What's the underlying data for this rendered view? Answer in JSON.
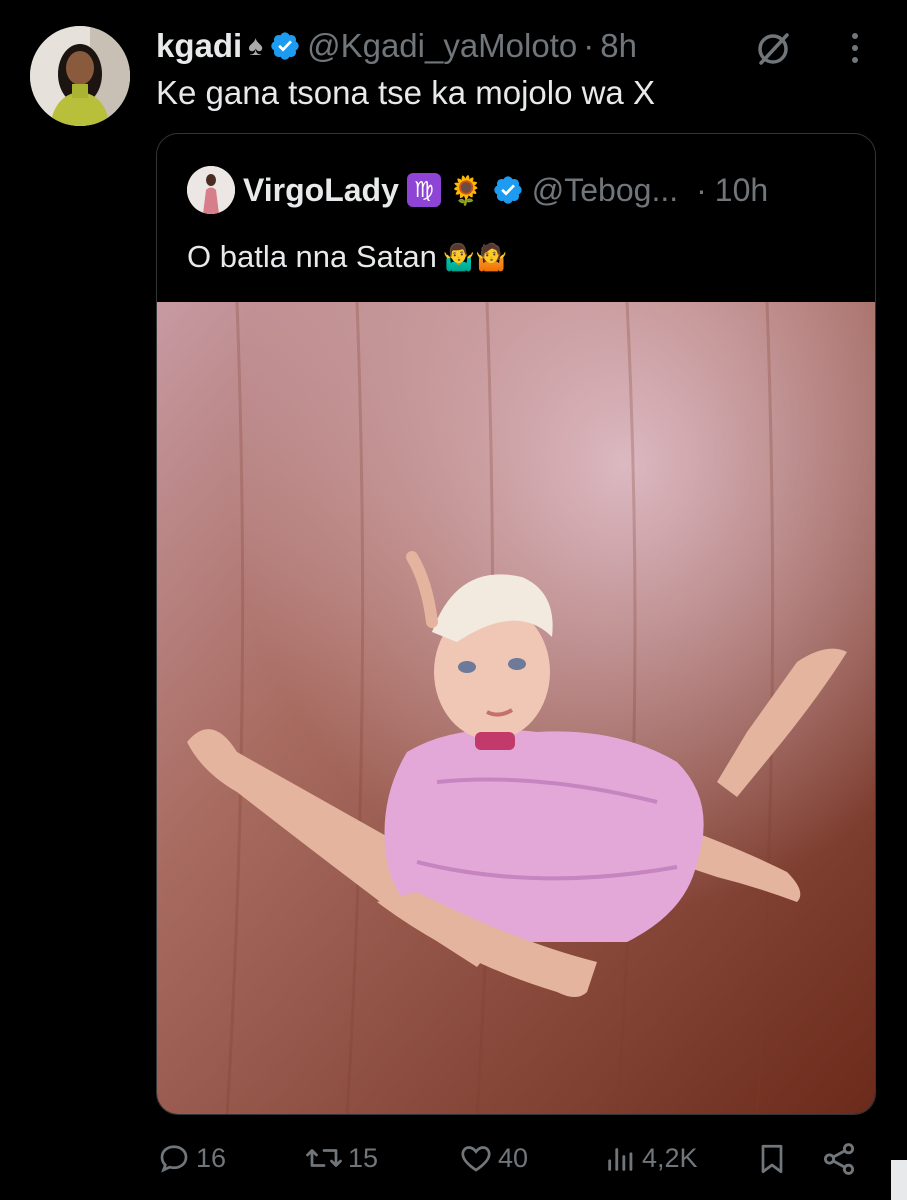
{
  "tweet": {
    "author_name": "kgadi",
    "author_suffix_emoji": "♠",
    "handle": "@Kgadi_yaMoloto",
    "separator": "·",
    "time": "8h",
    "text": "Ke gana tsona tse ka mojolo wa X"
  },
  "quote": {
    "author_name": "VirgoLady",
    "badge_virgo": "♍",
    "badge_flower": "🌻",
    "handle": "@Tebog...",
    "separator": "·",
    "time": "10h",
    "text": "O batla nna Satan",
    "text_emoji": "🤷‍♂️🤷"
  },
  "actions": {
    "replies": "16",
    "reposts": "15",
    "likes": "40",
    "views": "4,2K"
  },
  "colors": {
    "background": "#000000",
    "text": "#e7e9ea",
    "muted": "#71767b",
    "verified": "#1d9bf0",
    "border": "#333639"
  },
  "icons": [
    "grok-slash-icon",
    "more-icon",
    "verified-icon",
    "reply-icon",
    "repost-icon",
    "like-icon",
    "views-icon",
    "bookmark-icon",
    "share-icon"
  ]
}
